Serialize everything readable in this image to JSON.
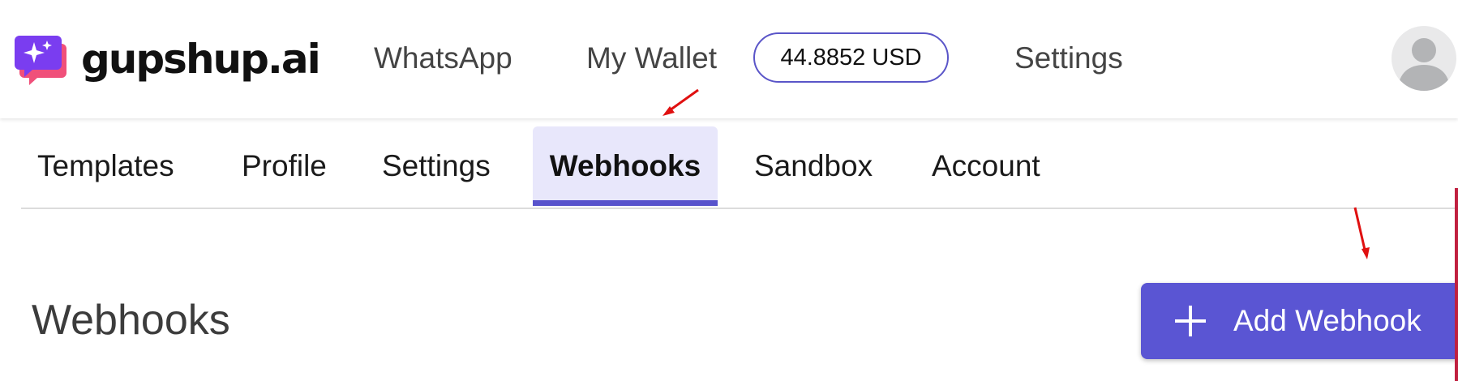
{
  "header": {
    "brand": "gupshup.ai",
    "nav": {
      "whatsapp": "WhatsApp",
      "my_wallet": "My Wallet",
      "settings": "Settings"
    },
    "wallet_balance": "44.8852 USD",
    "avatar_icon": "user-avatar-icon"
  },
  "tabs": [
    {
      "label": "Templates",
      "active": false
    },
    {
      "label": "Profile",
      "active": false
    },
    {
      "label": "Settings",
      "active": false
    },
    {
      "label": "Webhooks",
      "active": true
    },
    {
      "label": "Sandbox",
      "active": false
    },
    {
      "label": "Account",
      "active": false
    }
  ],
  "main": {
    "title": "Webhooks",
    "add_button": {
      "label": "Add Webhook",
      "icon": "plus-icon"
    }
  },
  "colors": {
    "accent": "#5a55d3",
    "active_tab_bg": "#e8e7fb",
    "annotation_arrow": "#e01010"
  }
}
